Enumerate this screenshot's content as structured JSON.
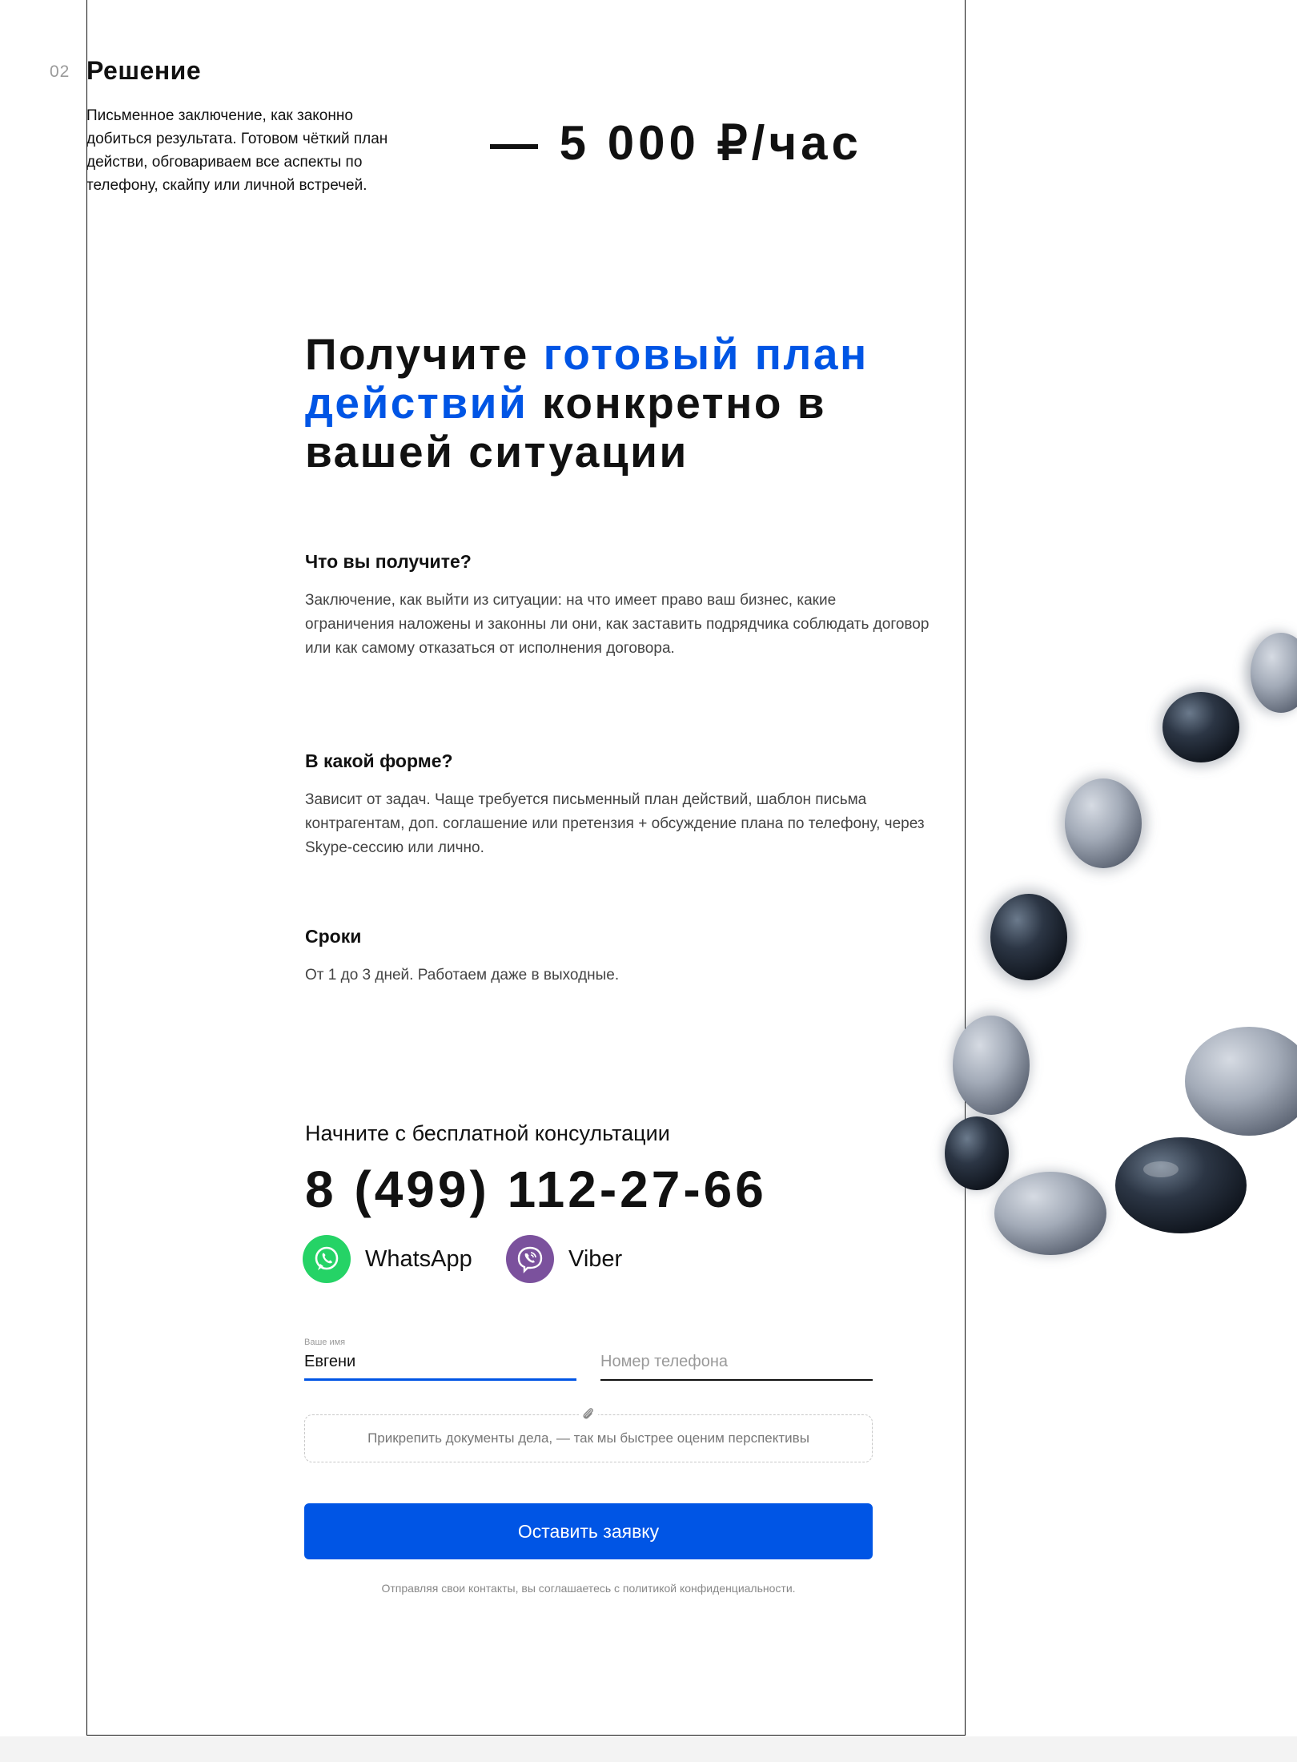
{
  "solution": {
    "number": "02",
    "title": "Решение",
    "description": "Письменное заключение, как законно добиться результата. Готовом чёткий план действи, обговариваем все аспекты по телефону, скайпу или личной встречей.",
    "price": "— 5 000 ₽/час"
  },
  "headline": {
    "part1": "Получите ",
    "highlight": "готовый план действий",
    "part2": " конкретно в вашей ситуации"
  },
  "faq": [
    {
      "title": "Что вы получите?",
      "text": "Заключение, как выйти из ситуации: на что имеет право ваш бизнес, какие ограничения наложены и законны ли они, как заставить подрядчика соблюдать договор или как самому отказаться от исполнения договора."
    },
    {
      "title": "В какой форме?",
      "text": "Зависит от задач. Чаще требуется письменный план действий, шаблон письма контрагентам, доп. соглашение или претензия + обсуждение плана по телефону, через Skype-сессию или лично."
    },
    {
      "title": "Сроки",
      "text": "От 1 до 3 дней. Работаем даже в выходные."
    }
  ],
  "cta": {
    "title": "Начните с бесплатной консультации",
    "phone": "8 (499) 112-27-66",
    "whatsapp_label": "WhatsApp",
    "viber_label": "Viber"
  },
  "form": {
    "name_label": "Ваше имя",
    "name_value": "Евгени",
    "phone_placeholder": "Номер телефона",
    "attach_text": "Прикрепить документы дела, — так мы быстрее оценим перспективы",
    "submit_label": "Оставить заявку",
    "consent": "Отправляя свои контакты, вы соглашаетесь с политикой конфиденциальности."
  },
  "colors": {
    "accent": "#0055e5",
    "whatsapp": "#25d366",
    "viber": "#7b519d"
  },
  "icons": [
    "whatsapp-icon",
    "viber-icon",
    "paperclip-icon"
  ]
}
